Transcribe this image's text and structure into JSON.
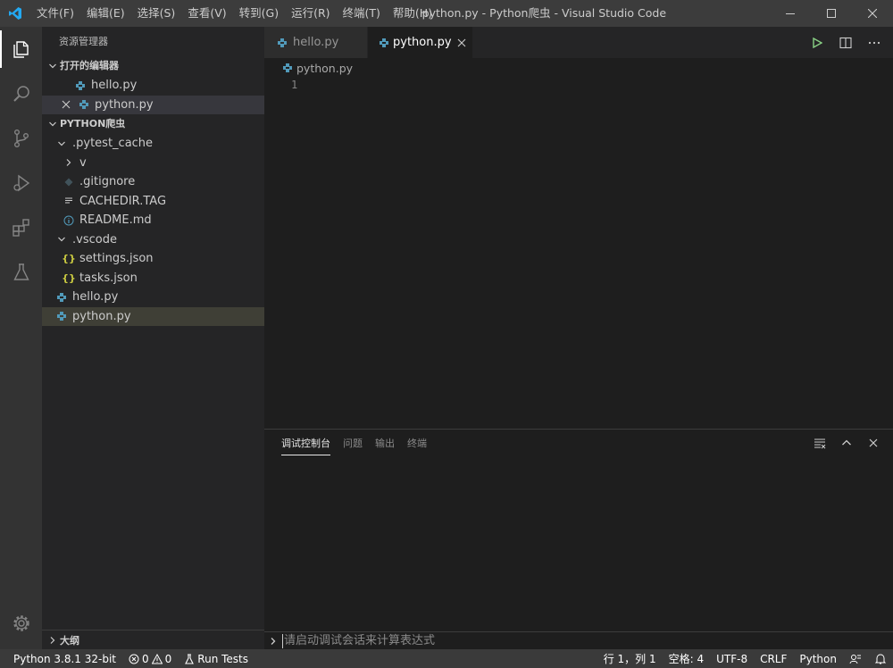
{
  "titlebar": {
    "menu": [
      "文件(F)",
      "编辑(E)",
      "选择(S)",
      "查看(V)",
      "转到(G)",
      "运行(R)",
      "终端(T)",
      "帮助(H)"
    ],
    "window_title": "python.py - Python爬虫 - Visual Studio Code"
  },
  "sidebar": {
    "title": "资源管理器",
    "open_editors": {
      "header": "打开的编辑器",
      "items": [
        "hello.py",
        "python.py"
      ]
    },
    "project": {
      "header": "PYTHON爬虫",
      "items": [
        ".pytest_cache",
        "v",
        ".gitignore",
        "CACHEDIR.TAG",
        "README.md",
        ".vscode",
        "settings.json",
        "tasks.json",
        "hello.py",
        "python.py"
      ]
    },
    "outline": "大纲"
  },
  "editor": {
    "tabs": [
      "hello.py",
      "python.py"
    ],
    "breadcrumb": "python.py",
    "line_number": "1"
  },
  "panel": {
    "tabs": [
      "调试控制台",
      "问题",
      "输出",
      "终端"
    ],
    "input_placeholder": "请启动调试会话来计算表达式"
  },
  "statusbar": {
    "interpreter": "Python 3.8.1 32-bit",
    "errors": "0",
    "warnings": "0",
    "run_tests": "Run Tests",
    "position": "行 1，列 1",
    "spaces": "空格: 4",
    "encoding": "UTF-8",
    "eol": "CRLF",
    "language": "Python"
  },
  "colors": {
    "python_icon": "#519aba",
    "json_icon": "#cbcb41",
    "vscode_blue": "#23a9f2",
    "run_green": "#89d185"
  }
}
